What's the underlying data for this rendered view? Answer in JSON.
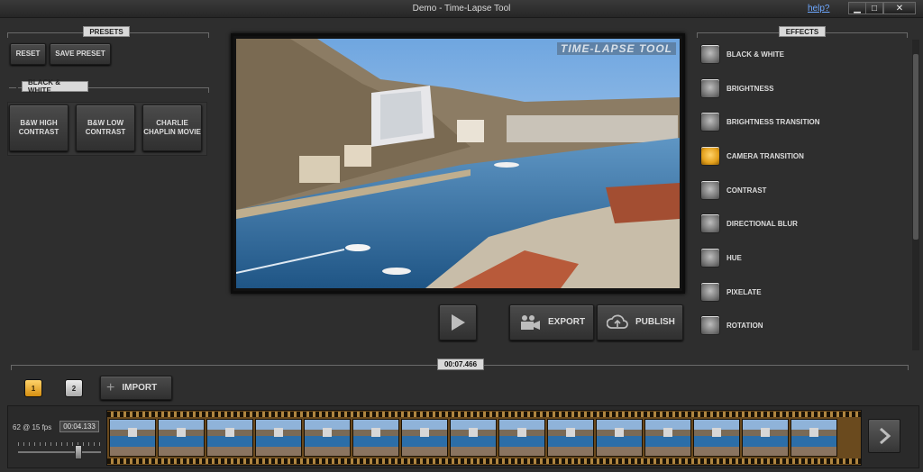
{
  "window": {
    "title": "Demo - Time-Lapse Tool",
    "help_label": "help?",
    "minimize_label": "▁",
    "maximize_label": "□",
    "close_label": "✕"
  },
  "presets": {
    "section_title": "PRESETS",
    "reset_label": "RESET",
    "save_preset_label": "SAVE PRESET",
    "group_title": "BLACK & WHITE",
    "items": [
      {
        "label": "B&W HIGH CONTRAST"
      },
      {
        "label": "B&W LOW CONTRAST"
      },
      {
        "label": "CHARLIE CHAPLIN MOVIE"
      }
    ]
  },
  "preview": {
    "watermark": "TIME-LAPSE TOOL"
  },
  "controls": {
    "export_label": "EXPORT",
    "publish_label": "PUBLISH"
  },
  "effects": {
    "section_title": "EFFECTS",
    "items": [
      {
        "label": "BLACK & WHITE",
        "active": false
      },
      {
        "label": "BRIGHTNESS",
        "active": false
      },
      {
        "label": "BRIGHTNESS TRANSITION",
        "active": false
      },
      {
        "label": "CAMERA TRANSITION",
        "active": true
      },
      {
        "label": "CONTRAST",
        "active": false
      },
      {
        "label": "DIRECTIONAL BLUR",
        "active": false
      },
      {
        "label": "HUE",
        "active": false
      },
      {
        "label": "PIXELATE",
        "active": false
      },
      {
        "label": "ROTATION",
        "active": false
      }
    ]
  },
  "timeline": {
    "total_time": "00:07.466",
    "tabs": [
      "1",
      "2"
    ],
    "import_label": "IMPORT",
    "fps_label": "62 @ 15 fps",
    "frame_duration": "00:04.133"
  },
  "colors": {
    "accent": "#e3a01c",
    "background": "#2e2e2e"
  }
}
